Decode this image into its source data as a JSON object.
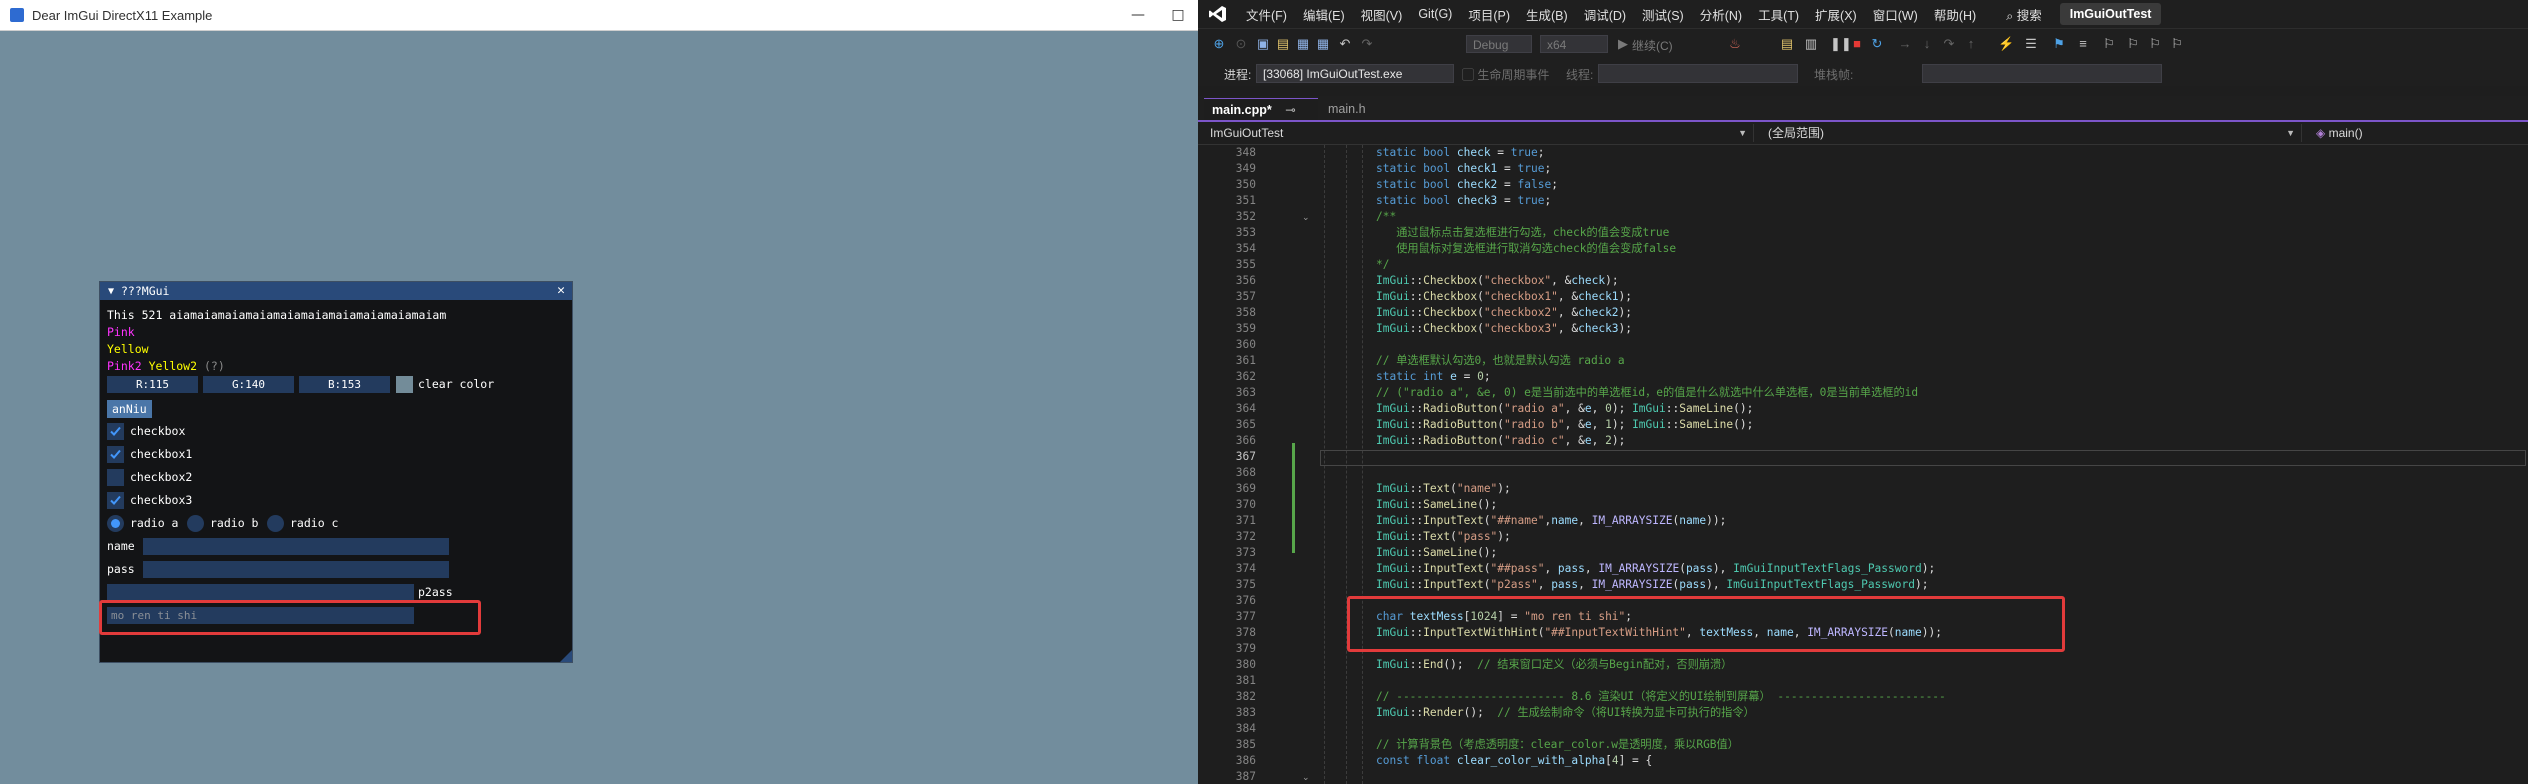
{
  "imgui_window": {
    "title": "Dear ImGui DirectX11 Example",
    "controls": [
      "—",
      "□"
    ],
    "panel": {
      "title": "???MGui",
      "text_line": "This 521 aiamaiamaiamaiamaiamaiamaiamaiamaiamaiam",
      "pink": "Pink",
      "yellow": "Yellow",
      "pink2": "Pink2",
      "yellow2": "Yellow2",
      "help_marker": "(?)",
      "color_r": "R:115",
      "color_g": "G:140",
      "color_b": "B:153",
      "clear_color_label": "clear color",
      "button_label": "anNiu",
      "checkboxes": [
        {
          "label": "checkbox",
          "checked": true
        },
        {
          "label": "checkbox1",
          "checked": true
        },
        {
          "label": "checkbox2",
          "checked": false
        },
        {
          "label": "checkbox3",
          "checked": true
        }
      ],
      "radios": [
        {
          "label": "radio a",
          "selected": true
        },
        {
          "label": "radio b",
          "selected": false
        },
        {
          "label": "radio c",
          "selected": false
        }
      ],
      "name_label": "name",
      "pass_label": "pass",
      "p2ass_label": "p2ass",
      "hint_text": "mo ren ti shi"
    }
  },
  "vs": {
    "menu": [
      "文件(F)",
      "编辑(E)",
      "视图(V)",
      "Git(G)",
      "项目(P)",
      "生成(B)",
      "调试(D)",
      "测试(S)",
      "分析(N)",
      "工具(T)",
      "扩展(X)",
      "窗口(W)",
      "帮助(H)"
    ],
    "search_label": "搜索",
    "project_name": "ImGuiOutTest",
    "config": "Debug",
    "platform": "x64",
    "continue_label": "继续(C)",
    "process_label": "进程:",
    "process_value": "[33068] ImGuiOutTest.exe",
    "lifecycle_label": "生命周期事件",
    "thread_label": "线程:",
    "stack_label": "堆栈帧:",
    "tabs": [
      {
        "label": "main.cpp*",
        "active": true
      },
      {
        "label": "main.h",
        "active": false
      }
    ],
    "nav": {
      "project": "ImGuiOutTest",
      "scope": "(全局范围)",
      "member": "main()"
    },
    "code": [
      {
        "n": "348",
        "html": "<span class=\"k\">static</span> <span class=\"k\">bool</span> <span class=\"v\">check</span> = <span class=\"k\">true</span>;"
      },
      {
        "n": "349",
        "html": "<span class=\"k\">static</span> <span class=\"k\">bool</span> <span class=\"v\">check1</span> = <span class=\"k\">true</span>;"
      },
      {
        "n": "350",
        "html": "<span class=\"k\">static</span> <span class=\"k\">bool</span> <span class=\"v\">check2</span> = <span class=\"k\">false</span>;"
      },
      {
        "n": "351",
        "html": "<span class=\"k\">static</span> <span class=\"k\">bool</span> <span class=\"v\">check3</span> = <span class=\"k\">true</span>;"
      },
      {
        "n": "352",
        "html": "<span class=\"c\">/**</span>"
      },
      {
        "n": "353",
        "html": "<span class=\"c\">   通过鼠标点击复选框进行勾选，check的值会变成true</span>"
      },
      {
        "n": "354",
        "html": "<span class=\"c\">   使用鼠标对复选框进行取消勾选check的值会变成false</span>"
      },
      {
        "n": "355",
        "html": "<span class=\"c\">*/</span>"
      },
      {
        "n": "356",
        "html": "<span class=\"t\">ImGui</span>::<span class=\"f\">Checkbox</span>(<span class=\"s\">\"checkbox\"</span>, &amp;<span class=\"v\">check</span>);"
      },
      {
        "n": "357",
        "html": "<span class=\"t\">ImGui</span>::<span class=\"f\">Checkbox</span>(<span class=\"s\">\"checkbox1\"</span>, &amp;<span class=\"v\">check1</span>);"
      },
      {
        "n": "358",
        "html": "<span class=\"t\">ImGui</span>::<span class=\"f\">Checkbox</span>(<span class=\"s\">\"checkbox2\"</span>, &amp;<span class=\"v\">check2</span>);"
      },
      {
        "n": "359",
        "html": "<span class=\"t\">ImGui</span>::<span class=\"f\">Checkbox</span>(<span class=\"s\">\"checkbox3\"</span>, &amp;<span class=\"v\">check3</span>);"
      },
      {
        "n": "360",
        "html": ""
      },
      {
        "n": "361",
        "html": "<span class=\"c\">// 单选框默认勾选0，也就是默认勾选 radio a</span>"
      },
      {
        "n": "362",
        "html": "<span class=\"k\">static</span> <span class=\"k\">int</span> <span class=\"v\">e</span> = <span class=\"n\">0</span>;"
      },
      {
        "n": "363",
        "html": "<span class=\"c\">// (\"radio a\", &amp;e, 0) e是当前选中的单选框id，e的值是什么就选中什么单选框，0是当前单选框的id</span>"
      },
      {
        "n": "364",
        "html": "<span class=\"t\">ImGui</span>::<span class=\"f\">RadioButton</span>(<span class=\"s\">\"radio a\"</span>, &amp;<span class=\"v\">e</span>, <span class=\"n\">0</span>); <span class=\"t\">ImGui</span>::<span class=\"f\">SameLine</span>();"
      },
      {
        "n": "365",
        "html": "<span class=\"t\">ImGui</span>::<span class=\"f\">RadioButton</span>(<span class=\"s\">\"radio b\"</span>, &amp;<span class=\"v\">e</span>, <span class=\"n\">1</span>); <span class=\"t\">ImGui</span>::<span class=\"f\">SameLine</span>();"
      },
      {
        "n": "366",
        "html": "<span class=\"t\">ImGui</span>::<span class=\"f\">RadioButton</span>(<span class=\"s\">\"radio c\"</span>, &amp;<span class=\"v\">e</span>, <span class=\"n\">2</span>);"
      },
      {
        "n": "367",
        "html": ""
      },
      {
        "n": "368",
        "html": ""
      },
      {
        "n": "369",
        "html": "<span class=\"t\">ImGui</span>::<span class=\"f\">Text</span>(<span class=\"s\">\"name\"</span>);"
      },
      {
        "n": "370",
        "html": "<span class=\"t\">ImGui</span>::<span class=\"f\">SameLine</span>();"
      },
      {
        "n": "371",
        "html": "<span class=\"t\">ImGui</span>::<span class=\"f\">InputText</span>(<span class=\"s\">\"##name\"</span>,<span class=\"v\">name</span>, <span class=\"m\">IM_ARRAYSIZE</span>(<span class=\"v\">name</span>));"
      },
      {
        "n": "372",
        "html": "<span class=\"t\">ImGui</span>::<span class=\"f\">Text</span>(<span class=\"s\">\"pass\"</span>);"
      },
      {
        "n": "373",
        "html": "<span class=\"t\">ImGui</span>::<span class=\"f\">SameLine</span>();"
      },
      {
        "n": "374",
        "html": "<span class=\"t\">ImGui</span>::<span class=\"f\">InputText</span>(<span class=\"s\">\"##pass\"</span>, <span class=\"v\">pass</span>, <span class=\"m\">IM_ARRAYSIZE</span>(<span class=\"v\">pass</span>), <span class=\"t\">ImGuiInputTextFlags_Password</span>);"
      },
      {
        "n": "375",
        "html": "<span class=\"t\">ImGui</span>::<span class=\"f\">InputText</span>(<span class=\"s\">\"p2ass\"</span>, <span class=\"v\">pass</span>, <span class=\"m\">IM_ARRAYSIZE</span>(<span class=\"v\">pass</span>), <span class=\"t\">ImGuiInputTextFlags_Password</span>);"
      },
      {
        "n": "376",
        "html": ""
      },
      {
        "n": "377",
        "html": "<span class=\"k\">char</span> <span class=\"v\">textMess</span>[<span class=\"n\">1024</span>] = <span class=\"s\">\"mo ren ti shi\"</span>;"
      },
      {
        "n": "378",
        "html": "<span class=\"t\">ImGui</span>::<span class=\"f\">InputTextWithHint</span>(<span class=\"s\">\"##InputTextWithHint\"</span>, <span class=\"v\">textMess</span>, <span class=\"v\">name</span>, <span class=\"m\">IM_ARRAYSIZE</span>(<span class=\"v\">name</span>));"
      },
      {
        "n": "379",
        "html": ""
      },
      {
        "n": "380",
        "html": "<span class=\"t\">ImGui</span>::<span class=\"f\">End</span>();  <span class=\"c\">// 结束窗口定义（必须与Begin配对，否则崩溃）</span>"
      },
      {
        "n": "381",
        "html": ""
      },
      {
        "n": "382",
        "html": "<span class=\"c\">// ------------------------- 8.6 渲染UI（将定义的UI绘制到屏幕） -------------------------</span>"
      },
      {
        "n": "383",
        "html": "<span class=\"t\">ImGui</span>::<span class=\"f\">Render</span>();  <span class=\"c\">// 生成绘制命令（将UI转换为显卡可执行的指令）</span>"
      },
      {
        "n": "384",
        "html": ""
      },
      {
        "n": "385",
        "html": "<span class=\"c\">// 计算背景色（考虑透明度：clear_color.w是透明度，乘以RGB值）</span>"
      },
      {
        "n": "386",
        "html": "<span class=\"k\">const</span> <span class=\"k\">float</span> <span class=\"v\">clear_color_with_alpha</span>[<span class=\"n\">4</span>] = {"
      },
      {
        "n": "387",
        "html": ""
      }
    ],
    "current_line": "367"
  }
}
